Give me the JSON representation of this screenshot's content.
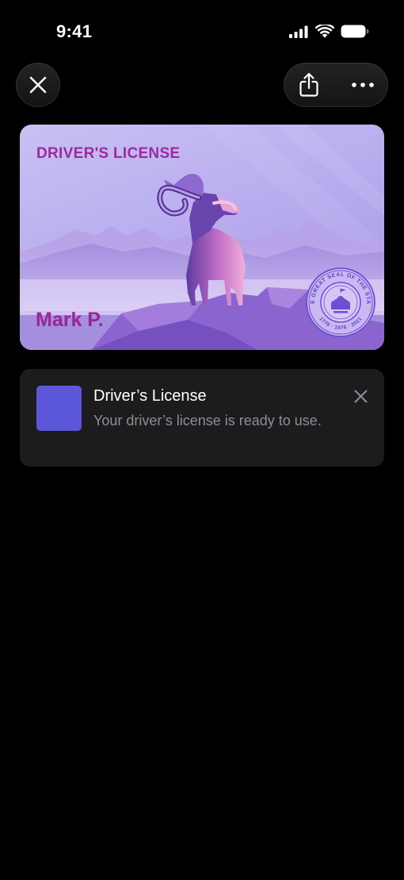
{
  "status_bar": {
    "time": "9:41"
  },
  "toolbar": {
    "close_icon": "xmark-icon",
    "share_icon": "share-icon",
    "more_icon": "ellipsis-icon"
  },
  "card": {
    "title": "DRIVER'S LICENSE",
    "name": "Mark P.",
    "seal_text": "THE GREAT SEAL OF THE STATE",
    "seal_years": "1776 · 1976 · 2021",
    "colors": {
      "title": "#9b2a9e",
      "background": "#b9adef"
    }
  },
  "notification": {
    "title": "Driver’s License",
    "body": "Your driver’s license is ready to use.",
    "thumbnail_color": "#5b57d8"
  }
}
